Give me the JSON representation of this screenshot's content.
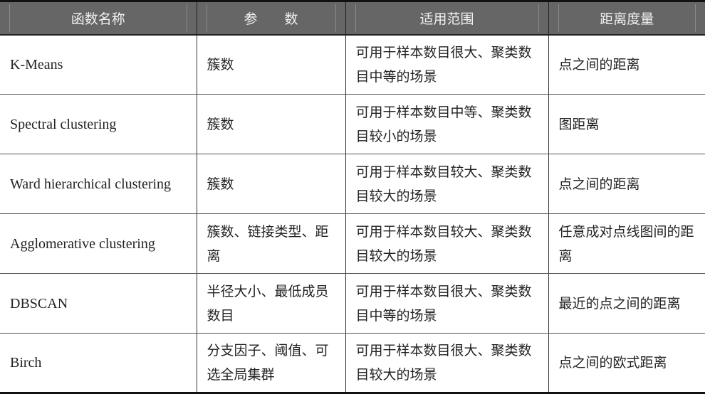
{
  "table": {
    "headers": [
      "函数名称",
      "参　　数",
      "适用范围",
      "距离度量"
    ],
    "rows": [
      {
        "name": "K-Means",
        "params": "簇数",
        "scope": "可用于样本数目很大、聚类数目中等的场景",
        "metric": "点之间的距离"
      },
      {
        "name": "Spectral clustering",
        "params": "簇数",
        "scope": "可用于样本数目中等、聚类数目较小的场景",
        "metric": "图距离"
      },
      {
        "name": "Ward hierarchical clustering",
        "params": "簇数",
        "scope": "可用于样本数目较大、聚类数目较大的场景",
        "metric": "点之间的距离"
      },
      {
        "name": "Agglomerative clustering",
        "params": "簇数、链接类型、距离",
        "scope": "可用于样本数目较大、聚类数目较大的场景",
        "metric": "任意成对点线图间的距离"
      },
      {
        "name": "DBSCAN",
        "params": "半径大小、最低成员数目",
        "scope": "可用于样本数目很大、聚类数目中等的场景",
        "metric": "最近的点之间的距离"
      },
      {
        "name": "Birch",
        "params": "分支因子、阈值、可选全局集群",
        "scope": "可用于样本数目很大、聚类数目较大的场景",
        "metric": "点之间的欧式距离"
      }
    ]
  },
  "colors": {
    "header_bg": "#666666",
    "header_text": "#f2f2f2",
    "border": "#111111"
  }
}
